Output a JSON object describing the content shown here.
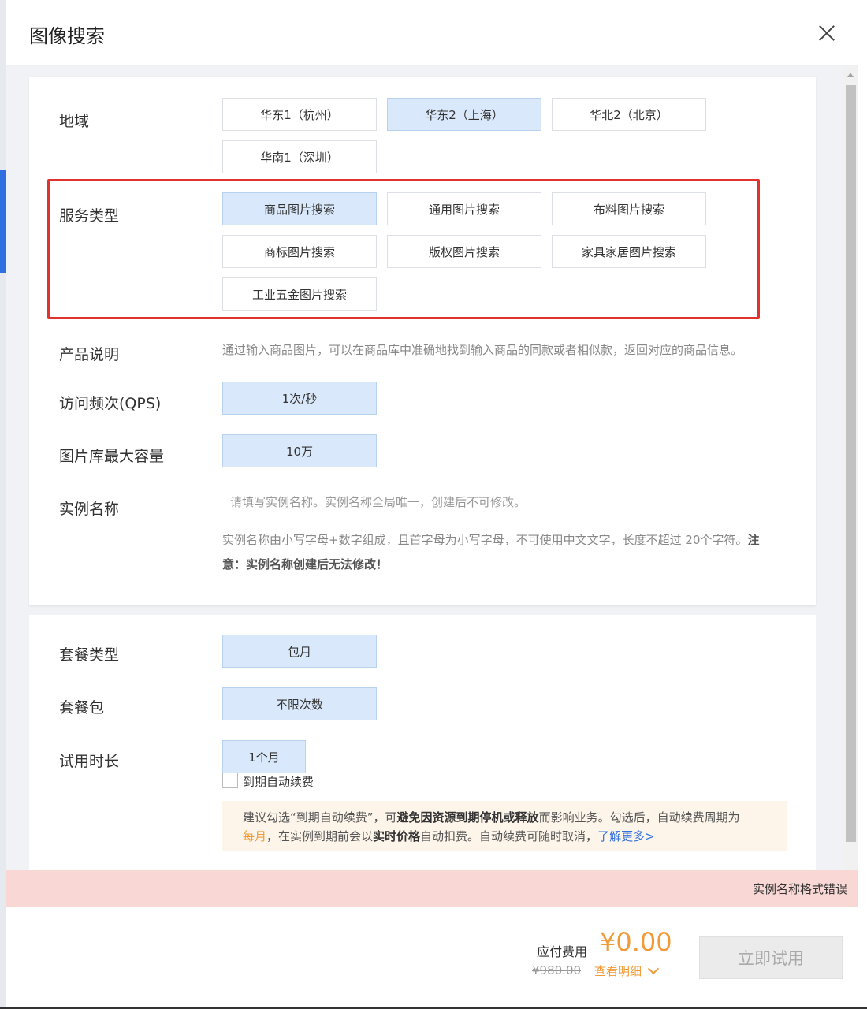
{
  "dialog": {
    "title": "图像搜索"
  },
  "region": {
    "label": "地域",
    "options": [
      "华东1（杭州）",
      "华东2（上海）",
      "华北2（北京）",
      "华南1（深圳）"
    ],
    "selected": "华东2（上海）"
  },
  "service_type": {
    "label": "服务类型",
    "options": [
      "商品图片搜索",
      "通用图片搜索",
      "布料图片搜索",
      "商标图片搜索",
      "版权图片搜索",
      "家具家居图片搜索",
      "工业五金图片搜索"
    ],
    "selected": "商品图片搜索"
  },
  "product_desc": {
    "label": "产品说明",
    "text": "通过输入商品图片，可以在商品库中准确地找到输入商品的同款或者相似款，返回对应的商品信息。"
  },
  "qps": {
    "label": "访问频次(QPS)",
    "option": "1次/秒"
  },
  "capacity": {
    "label": "图片库最大容量",
    "option": "10万"
  },
  "instance_name": {
    "label": "实例名称",
    "placeholder": "请填写实例名称。实例名称全局唯一，创建后不可修改。",
    "value": "",
    "hint_normal": "实例名称由小写字母+数字组成，且首字母为小写字母，不可使用中文文字，长度不超过 20个字符。",
    "hint_bold": "注意：实例名称创建后无法修改！"
  },
  "package_type": {
    "label": "套餐类型",
    "option": "包月"
  },
  "package": {
    "label": "套餐包",
    "option": "不限次数"
  },
  "trial_duration": {
    "label": "试用时长",
    "option": "1个月"
  },
  "auto_renew": {
    "label": "到期自动续费",
    "checked": false,
    "notice_1": "建议勾选“到期自动续费”，可",
    "notice_bold_1": "避免因资源到期停机或释放",
    "notice_2": "而影响业务。勾选后，自动续费周期为",
    "notice_orange": "每月",
    "notice_3": "，在实例到期前会以",
    "notice_bold_2": "实时价格",
    "notice_4": "自动扣费。自动续费可随时取消，",
    "notice_link": "了解更多>"
  },
  "error": {
    "text": "实例名称格式错误"
  },
  "footer": {
    "pay_label": "应付费用",
    "price": "¥0.00",
    "original_price": "¥980.00",
    "detail_link": "查看明细",
    "try_button": "立即试用"
  },
  "colors": {
    "selected_bg": "#d9e8fa",
    "highlight_border": "#e0332d",
    "price_orange": "#f29a38",
    "error_bg": "#f8d7d4",
    "link_blue": "#2f6fe0"
  }
}
